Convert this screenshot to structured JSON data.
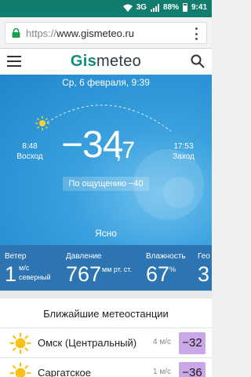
{
  "status_bar": {
    "network": "3G",
    "battery": "88%",
    "time": "9:41"
  },
  "browser": {
    "url_protocol": "https://",
    "url_host": "www.gismeteo.ru"
  },
  "header": {
    "logo_part1": "Gis",
    "logo_part2": "meteo"
  },
  "weather": {
    "date": "Ср, 6 февраля, 9:39",
    "sunrise_time": "8:48",
    "sunrise_label": "Восход",
    "sunset_time": "17:53",
    "sunset_label": "Заход",
    "temperature_int": "−34",
    "temperature_dec": ",7",
    "feels_like": "По ощущению −40",
    "condition": "Ясно"
  },
  "stats": {
    "wind_label": "Ветер",
    "wind_value": "1",
    "wind_unit": "м/с",
    "wind_dir": "северный",
    "pressure_label": "Давление",
    "pressure_value": "767",
    "pressure_unit": "мм рт. ст.",
    "humidity_label": "Влажность",
    "humidity_value": "67",
    "humidity_unit": "%",
    "extra_label": "Гео",
    "extra_value": "3"
  },
  "nearby": {
    "title": "Ближайшие метеостанции",
    "stations": [
      {
        "name": "Омск (Центральный)",
        "wind": "4 м/с",
        "temp": "−32"
      },
      {
        "name": "Саргатское",
        "wind": "1 м/с",
        "temp": "−36"
      }
    ]
  },
  "colors": {
    "status_bar": "#107d6f",
    "hero_blue": "#1f86cd",
    "stats_band": "#2d74b2",
    "brand_green": "#0b8d7d",
    "station_temp_badge": "#c8a8e6"
  }
}
